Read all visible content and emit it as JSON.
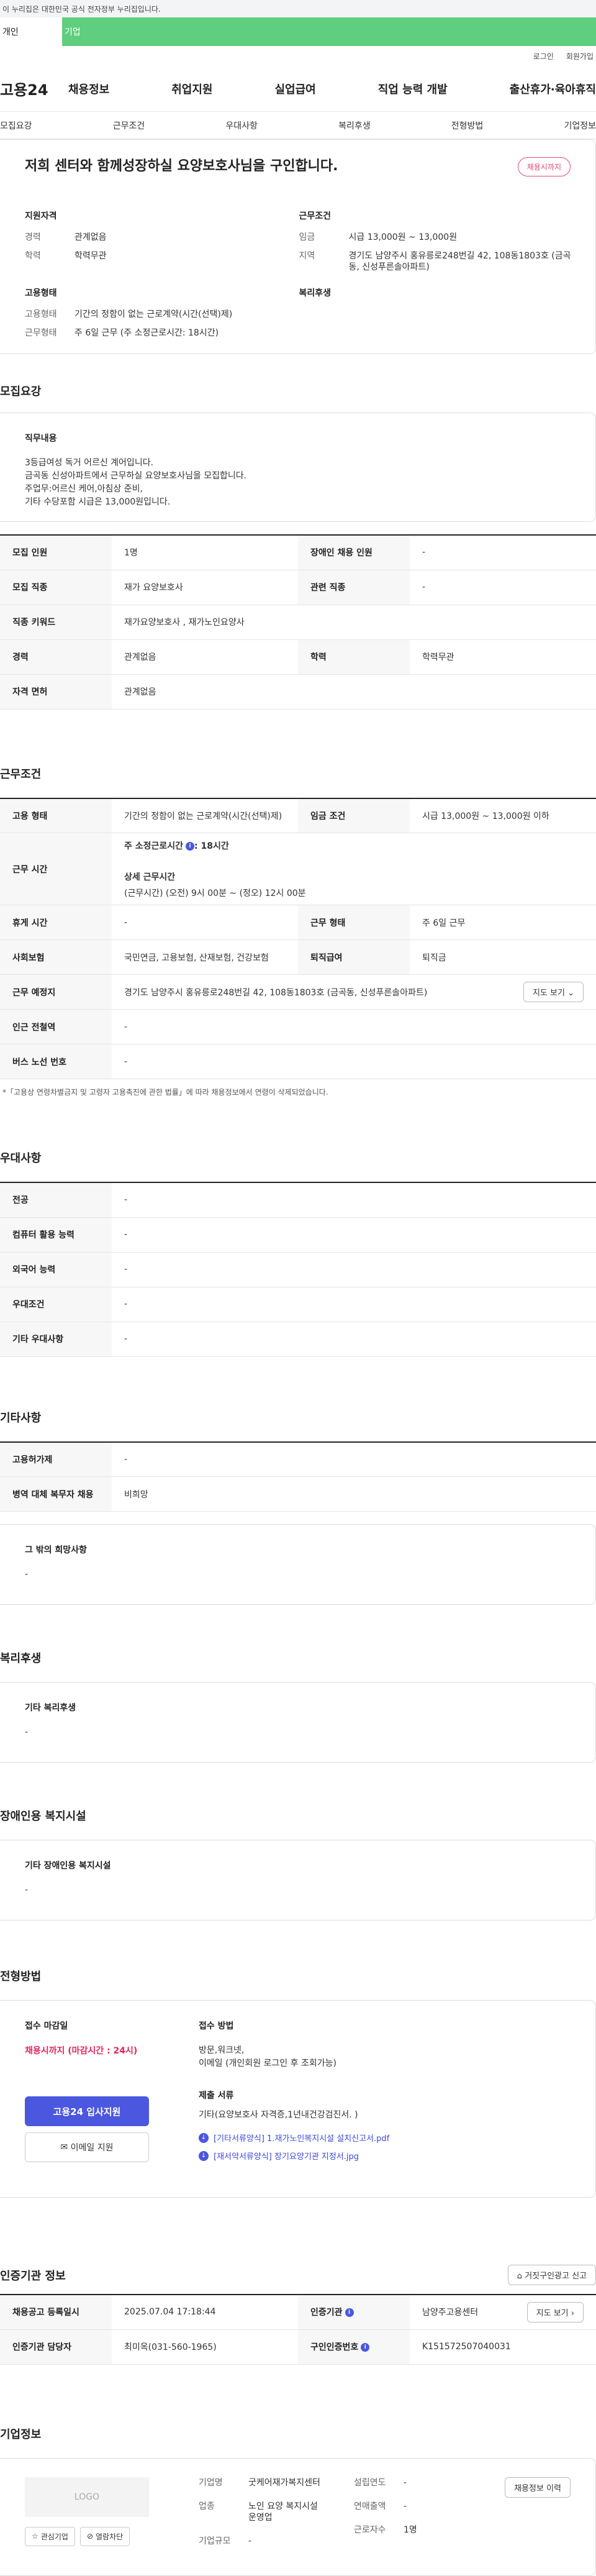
{
  "gov_banner": "이 누리집은 대한민국 공식 전자정부 누리집입니다.",
  "tabs": {
    "personal": "개인",
    "company": "기업"
  },
  "util": {
    "login": "로그인",
    "join": "회원가입"
  },
  "logo": "고용24",
  "gnb": [
    "채용정보",
    "취업지원",
    "실업급여",
    "직업 능력 개발",
    "출산휴가·육아휴직"
  ],
  "anchor_nav": [
    "모집요강",
    "근무조건",
    "우대사항",
    "복리후생",
    "전형방법",
    "기업정보"
  ],
  "summary": {
    "title": "저희 센터와 함께성장하실 요양보호사님을 구인합니다.",
    "deadline_pill": "채용시까지",
    "qual_header": "지원자격",
    "qual": [
      {
        "k": "경력",
        "v": "관계없음"
      },
      {
        "k": "학력",
        "v": "학력무관"
      }
    ],
    "emp_header": "고용형태",
    "emp": [
      {
        "k": "고용형태",
        "v": "기간의 정함이 없는 근로계약(시간(선택)제)"
      },
      {
        "k": "근무형태",
        "v": "주 6일 근무 (주 소정근로시간: 18시간)"
      }
    ],
    "cond_header": "근무조건",
    "cond": [
      {
        "k": "임금",
        "v": "시급 13,000원 ~ 13,000원"
      },
      {
        "k": "지역",
        "v": "경기도 남양주시 홍유릉로248번길 42, 108동1803호 (금곡동, 신성푸른솔아파트)"
      }
    ],
    "welfare_header": "복리후생"
  },
  "recruit": {
    "title": "모집요강",
    "duty_header": "직무내용",
    "duty_lines": [
      "3등급여성 독거 어르신 계어입니다.",
      "금곡동 신성아파트에서 근무하실 요양보호사님을 모집합니다.",
      "주업무:어르신 케어,아침상 준비,",
      "기타 수당포함 시급은 13,000원입니다."
    ],
    "rows": [
      [
        "모집 인원",
        "1명",
        "장애인 채용 인원",
        "-"
      ],
      [
        "모집 직종",
        "재가 요양보호사",
        "관련 직종",
        "-"
      ],
      [
        "직종 키워드",
        "재가요양보호사 , 재가노인요양사",
        "",
        ""
      ],
      [
        "경력",
        "관계없음",
        "학력",
        "학력무관"
      ],
      [
        "자격 면허",
        "관계없음",
        "",
        ""
      ]
    ]
  },
  "work": {
    "title": "근무조건",
    "emp_type_label": "고용 형태",
    "emp_type": "기간의 정함이 없는 근로계약(시간(선택)제)",
    "wage_label": "임금 조건",
    "wage": "시급 13,000원 ~ 13,000원 이하",
    "hours_label": "근무 시간",
    "hours_weekly_label": "주 소정근로시간",
    "hours_weekly": ": 18시간",
    "hours_detail_label": "상세 근무시간",
    "hours_detail": "(근무시간) (오전) 9시 00분 ~ (정오) 12시 00분",
    "break_label": "휴게 시간",
    "break": "-",
    "shape_label": "근무 형태",
    "shape": "주 6일 근무",
    "insurance_label": "사회보험",
    "insurance": "국민연금, 고용보험, 산재보험, 건강보험",
    "severance_label": "퇴직급여",
    "severance": "퇴직금",
    "place_label": "근무 예정지",
    "place": "경기도 남양주시 홍유릉로248번길 42, 108동1803호 (금곡동, 신성푸른솔아파트)",
    "map_btn": "지도 보기",
    "subway_label": "인근 전철역",
    "subway": "-",
    "bus_label": "버스 노선 번호",
    "bus": "-",
    "note": "*「고용상 연령차별금지 및 고령자 고용촉진에 관한 법률」에 따라 채용정보에서 연령이 삭제되었습니다."
  },
  "prefer": {
    "title": "우대사항",
    "rows": [
      [
        "전공",
        "-"
      ],
      [
        "컴퓨터 활용 능력",
        "-"
      ],
      [
        "외국어 능력",
        "-"
      ],
      [
        "우대조건",
        "-"
      ],
      [
        "기타 우대사항",
        "-"
      ]
    ]
  },
  "etc": {
    "title": "기타사항",
    "rows": [
      [
        "고용허가제",
        "-"
      ],
      [
        "병역 대체 복무자 채용",
        "비희망"
      ]
    ],
    "other_header": "그 밖의 희망사항",
    "other": "-"
  },
  "welfare": {
    "title": "복리후생",
    "header": "기타 복리후생",
    "value": "-"
  },
  "disabled": {
    "title": "장애인용 복지시설",
    "header": "기타 장애인용 복지시설",
    "value": "-"
  },
  "selection": {
    "title": "전형방법",
    "deadline_header": "접수 마감일",
    "deadline": "채용시까지 (마감시간 : 24시)",
    "apply_btn": "고용24 입사지원",
    "email_btn": "이메일 지원",
    "method_header": "접수 방법",
    "method_lines": [
      "방문,워크넷,",
      "이메일 (개인회원 로그인 후 조회가능)"
    ],
    "docs_header": "제출 서류",
    "docs": "기타(요양보호사 자격증,1년내건강검진서. )",
    "files": [
      "[기타서류양식] 1.재가노인복지시설 설치신고서.pdf",
      "[재서약서류양식] 장기요양기관 지정서.jpg"
    ]
  },
  "agency": {
    "title": "인증기관 정보",
    "report_btn": "거짓구인광고 신고",
    "reg_label": "채용공고 등록일시",
    "reg": "2025.07.04 17:18:44",
    "agency_label": "인증기관",
    "agency": "남양주고용센터",
    "map_btn": "지도 보기",
    "manager_label": "인증기관 담당자",
    "manager": "최미옥(031-560-1965)",
    "cert_label": "구인인증번호",
    "cert": "K151572507040031"
  },
  "company": {
    "title": "기업정보",
    "logo_text": "LOGO",
    "interest_btn": "관심기업",
    "block_btn": "열람차단",
    "name_label": "기업명",
    "name": "굿케어재가복지센터",
    "industry_label": "업종",
    "industry": "노인 요양 복지시설 운영업",
    "size_label": "기업규모",
    "size": "-",
    "founded_label": "설립연도",
    "founded": "-",
    "revenue_label": "연매출액",
    "revenue": "-",
    "employees_label": "근로자수",
    "employees": "1명",
    "jobs_btn": "채용정보 이력"
  }
}
